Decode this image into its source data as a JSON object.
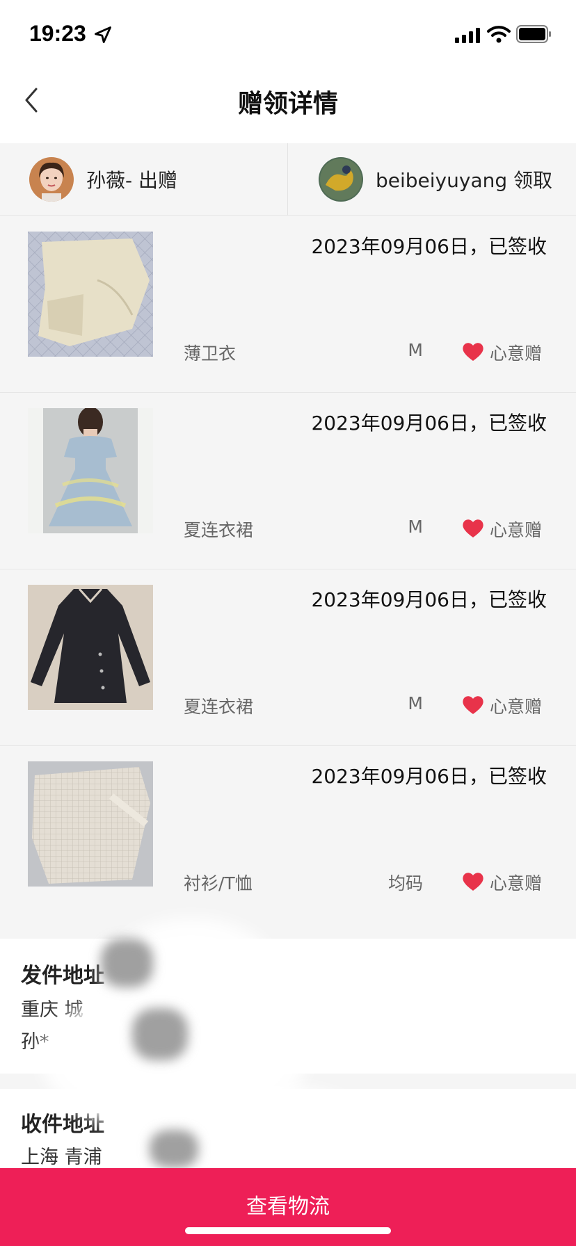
{
  "status_bar": {
    "time": "19:23"
  },
  "nav": {
    "title": "赠领详情"
  },
  "parties": {
    "giver_label": "孙薇- 出赠",
    "receiver_label": "beibeiyuyang 领取"
  },
  "items": [
    {
      "date_status": "2023年09月06日，已签收",
      "name": "薄卫衣",
      "size": "M",
      "tag": "心意赠"
    },
    {
      "date_status": "2023年09月06日，已签收",
      "name": "夏连衣裙",
      "size": "M",
      "tag": "心意赠"
    },
    {
      "date_status": "2023年09月06日，已签收",
      "name": "夏连衣裙",
      "size": "M",
      "tag": "心意赠"
    },
    {
      "date_status": "2023年09月06日，已签收",
      "name": "衬衫/T恤",
      "size": "均码",
      "tag": "心意赠"
    }
  ],
  "sender_address": {
    "title": "发件地址",
    "line1": "重庆 城",
    "line2": "孙*"
  },
  "receiver_address": {
    "title": "收件地址",
    "line1": "上海 青浦"
  },
  "bottom_button": {
    "label": "查看物流"
  },
  "colors": {
    "accent": "#ee1f57",
    "heart": "#e8334a",
    "background": "#f5f5f5"
  }
}
